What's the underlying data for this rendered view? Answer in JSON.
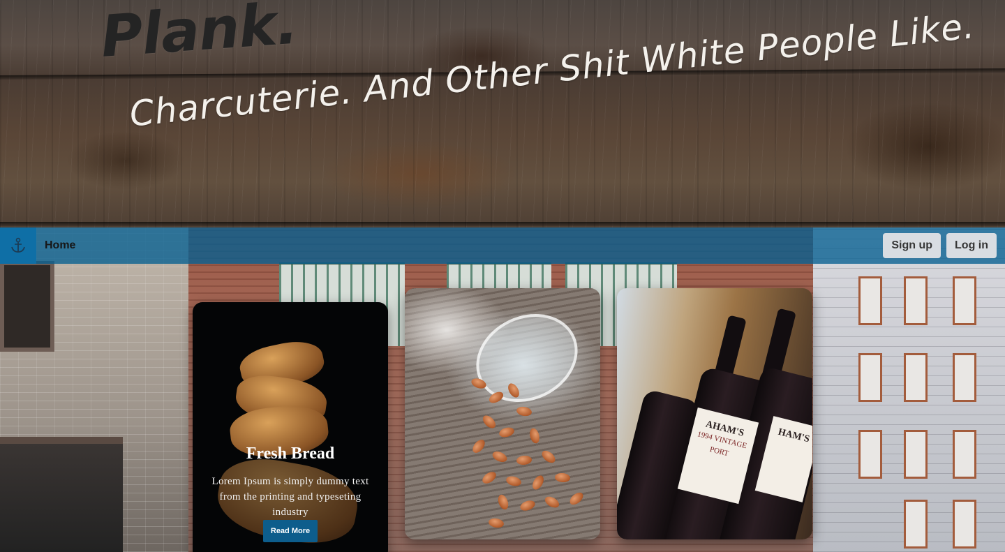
{
  "hero": {
    "brand": "Plank.",
    "tagline": "Charcuterie. And Other Shit White People Like."
  },
  "nav": {
    "logo_icon": "anchor-icon",
    "home_label": "Home",
    "signup_label": "Sign up",
    "login_label": "Log in",
    "bar_color": "#055f91"
  },
  "cards": [
    {
      "title": "Fresh Bread",
      "text": "Lorem Ipsum is simply dummy text from the printing and typeseting industry",
      "button_label": "Read More",
      "image": "bread-photo"
    },
    {
      "image": "almonds-jar-photo"
    },
    {
      "image": "port-wine-bottles-photo",
      "label_text": "AHAM'S",
      "label_sub": "1994 VINTAGE PORT",
      "label_text_2": "HAM'S"
    }
  ]
}
